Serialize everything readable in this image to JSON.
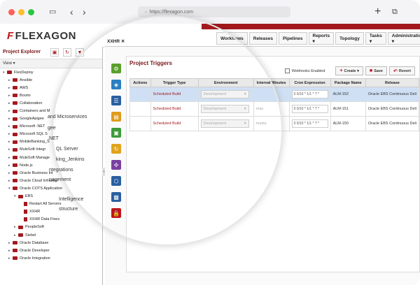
{
  "browser": {
    "url": "https://flexagon.com",
    "colors": {
      "close": "#ff5f57",
      "minimize": "#febc2e",
      "maximize": "#28c840"
    }
  },
  "app": {
    "logo_text": "FLEXAGON",
    "nav": [
      "Workflows",
      "Releases",
      "Pipelines",
      "Reports ▾",
      "Topology",
      "Tasks ▾",
      "Administration ▾"
    ],
    "accent_color": "#a31a1e"
  },
  "explorer": {
    "title": "Project Explorer",
    "view_label": "View",
    "tree": [
      {
        "label": "FlexDeploy",
        "level": 0,
        "type": "folder",
        "expanded": true
      },
      {
        "label": "Ansible",
        "level": 1,
        "type": "folder"
      },
      {
        "label": "AWS",
        "level": 1,
        "type": "folder"
      },
      {
        "label": "Boomi",
        "level": 1,
        "type": "folder"
      },
      {
        "label": "Collaboration",
        "level": 1,
        "type": "folder"
      },
      {
        "label": "Containers and M",
        "level": 1,
        "type": "folder"
      },
      {
        "label": "GoogleApigee",
        "level": 1,
        "type": "folder"
      },
      {
        "label": "Microsoft .NET",
        "level": 1,
        "type": "folder"
      },
      {
        "label": "Microsoft SQL S",
        "level": 1,
        "type": "folder"
      },
      {
        "label": "MobileBanking_S",
        "level": 1,
        "type": "folder"
      },
      {
        "label": "MuleSoft Integr",
        "level": 1,
        "type": "folder"
      },
      {
        "label": "MuleSoft Manage",
        "level": 1,
        "type": "folder"
      },
      {
        "label": "Node.js",
        "level": 1,
        "type": "folder"
      },
      {
        "label": "Oracle Business Int",
        "level": 1,
        "type": "folder"
      },
      {
        "label": "Oracle Cloud Infrastru",
        "level": 1,
        "type": "folder"
      },
      {
        "label": "Oracle COTS Application",
        "level": 1,
        "type": "folder",
        "expanded": true
      },
      {
        "label": "EBS",
        "level": 2,
        "type": "folder",
        "expanded": true
      },
      {
        "label": "Restart All Servers",
        "level": 3,
        "type": "file"
      },
      {
        "label": "XXHR",
        "level": 3,
        "type": "file"
      },
      {
        "label": "XXHR Data Fixes",
        "level": 3,
        "type": "file"
      },
      {
        "label": "PeopleSoft",
        "level": 2,
        "type": "folder"
      },
      {
        "label": "Siebel",
        "level": 2,
        "type": "folder"
      },
      {
        "label": "Oracle Database",
        "level": 1,
        "type": "folder"
      },
      {
        "label": "Oracle Developer",
        "level": 1,
        "type": "folder"
      },
      {
        "label": "Oracle Integration",
        "level": 1,
        "type": "folder"
      }
    ]
  },
  "magnified_tree_text": [
    "and Microservices",
    "gee",
    ".NET",
    "QL Server",
    "king_Jenkins",
    "ntegrations",
    "nagement",
    "Intelligence",
    "structure"
  ],
  "tab": {
    "label": "XXHR"
  },
  "panel": {
    "title": "Project Triggers",
    "webhooks_label": "Webhooks Enabled",
    "create_label": "Create",
    "save_label": "Save",
    "revert_label": "Revert",
    "columns": [
      "Actions",
      "Trigger Type",
      "Environment",
      "Interval Minutes",
      "Cron Expression",
      "Package Name",
      "Release"
    ],
    "rows": [
      {
        "type": "Scheduled Build",
        "environment": "Development",
        "interval": "",
        "cron": "0 0/10 * 1/1 * ? *",
        "package": "ALM-152",
        "release": "Oracle EBS Continuous Deli"
      },
      {
        "type": "Scheduled Build",
        "environment": "Development",
        "interval": "mas",
        "cron": "0 0/10 * 1/1 * ? *",
        "package": "ALM-151",
        "release": "Oracle EBS Continuous Deli"
      },
      {
        "type": "Scheduled Build",
        "environment": "Development",
        "interval": "maste",
        "cron": "0 0/10 * 1/1 * ? *",
        "package": "ALM-150",
        "release": "Oracle EBS Continuous Deli"
      }
    ]
  },
  "sidebar_icons": [
    {
      "name": "gear-icon",
      "color": "#5aa02c"
    },
    {
      "name": "diagram-icon",
      "color": "#2a7fc1"
    },
    {
      "name": "list-icon",
      "color": "#2a5fa0"
    },
    {
      "name": "document-icon",
      "color": "#e09b1c"
    },
    {
      "name": "package-icon",
      "color": "#3d9a3a"
    },
    {
      "name": "refresh-icon",
      "color": "#e0a41c"
    },
    {
      "name": "puzzle-icon",
      "color": "#7a3fa0"
    },
    {
      "name": "network-icon",
      "color": "#2a5fa0"
    },
    {
      "name": "image-icon",
      "color": "#2a5fa0"
    },
    {
      "name": "lock-icon",
      "color": "#c0151a"
    }
  ]
}
